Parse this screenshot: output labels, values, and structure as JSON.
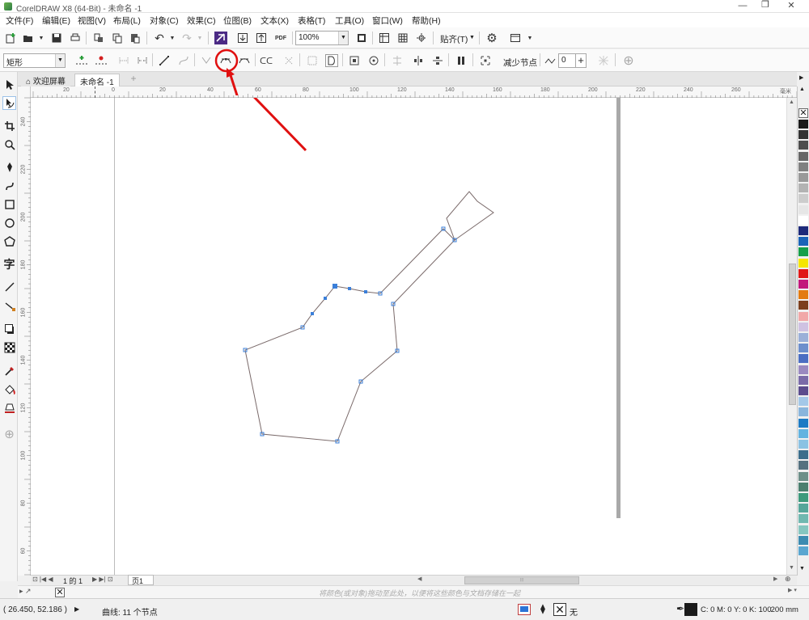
{
  "window": {
    "title": "CorelDRAW X8 (64-Bit) - 未命名 -1",
    "min": "—",
    "restore": "❐",
    "close": "✕"
  },
  "menu": [
    "文件(F)",
    "编辑(E)",
    "视图(V)",
    "布局(L)",
    "对象(C)",
    "效果(C)",
    "位图(B)",
    "文本(X)",
    "表格(T)",
    "工具(O)",
    "窗口(W)",
    "帮助(H)"
  ],
  "toolbar": {
    "zoom": "100%",
    "snap_label": "贴齐(T)",
    "export_pdf_label": "PDF",
    "shape_select": "矩形",
    "reduce_nodes_label": "减少节点",
    "smoothness_value": "0"
  },
  "tabs": {
    "home": "欢迎屏幕",
    "document": "未命名 -1",
    "add": "+"
  },
  "ruler_h": [
    "20",
    "0",
    "20",
    "40",
    "60",
    "80",
    "100",
    "120",
    "140",
    "160",
    "180",
    "200",
    "220",
    "240",
    "260"
  ],
  "ruler_unit": "毫米",
  "ruler_v": [
    "240",
    "220",
    "200",
    "180",
    "160",
    "140",
    "120",
    "100",
    "80",
    "60"
  ],
  "pager": {
    "page_count": "1 的 1",
    "page_tab": "页1"
  },
  "colorbar_hint": "将颜色(或对象)拖动至此处，以便将这些颜色与文档存储在一起",
  "status": {
    "coords": "( 26.450, 52.186 )",
    "selection": "曲线: 11 个节点",
    "fill_none": "无",
    "outline_color": "C: 0 M: 0 Y: 0 K: 100",
    "outline_width": ".200 mm"
  },
  "colors": {
    "accent_blue": "#2b73d6",
    "annotation_red": "#e01010",
    "curve_outline": "#7a6a6a",
    "nodes": "#3b7fd9"
  },
  "palette": [
    "#1a1a1a",
    "#333333",
    "#4d4d4d",
    "#666666",
    "#808080",
    "#999999",
    "#b3b3b3",
    "#cccccc",
    "#e6e6e6",
    "#ffffff",
    "#1e2a7a",
    "#1b64b8",
    "#159f4a",
    "#f5e600",
    "#e01818",
    "#c2187c",
    "#e37b12",
    "#7c3f1e",
    "#f1a8a8",
    "#cfc2e2",
    "#9bb0d8",
    "#6d8fcc",
    "#4b6ec2",
    "#9a8ac0",
    "#7a6ba8",
    "#5b4c8d",
    "#a4c8e8",
    "#8ab5dc",
    "#1e7bc4",
    "#63b3e0",
    "#8bc2e3",
    "#3c6e8c",
    "#55717f",
    "#6d8f88",
    "#4c7f6f",
    "#3e9a7c",
    "#56a69a",
    "#70b8b0",
    "#86c6c0",
    "#3c8bb1",
    "#5aa6d0"
  ]
}
